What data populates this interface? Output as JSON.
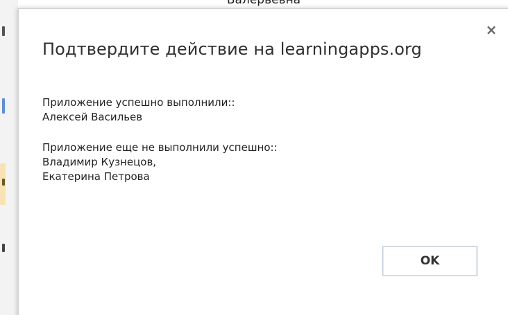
{
  "background": {
    "top_text": "Валерьевна"
  },
  "dialog": {
    "title": "Подтвердите действие на learningapps.org",
    "close_glyph": "×",
    "close_icon": "close-icon",
    "success_heading": "Приложение успешно выполнили::",
    "success_names": [
      "Алексей Васильев"
    ],
    "pending_heading": "Приложение еще не выполнили успешно::",
    "pending_names": [
      "Владимир Кузнецов,",
      "Екатерина Петрова"
    ],
    "ok_label": "OK"
  },
  "colors": {
    "button_border": "#b9c6d8",
    "title_text": "#303030"
  }
}
